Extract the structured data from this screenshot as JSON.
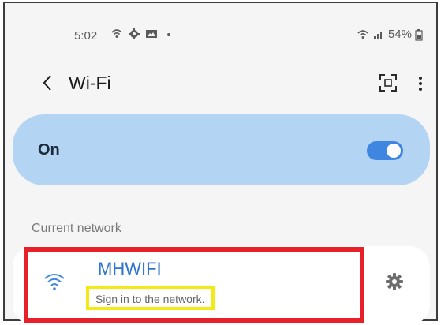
{
  "status_bar": {
    "time": "5:02",
    "left_icons": [
      "wifi-icon",
      "gear-icon",
      "image-icon",
      "dot-icon"
    ],
    "right_icons": [
      "wifi-icon",
      "signal-icon"
    ],
    "battery_percent": "54%"
  },
  "header": {
    "title": "Wi-Fi",
    "back_icon": "chevron-left-icon",
    "scan_icon": "qr-scan-icon",
    "more_icon": "more-vertical-icon"
  },
  "wifi_toggle": {
    "label": "On",
    "enabled": true
  },
  "current_network": {
    "section_label": "Current network",
    "name": "MHWIFI",
    "status": "Sign in to the network."
  },
  "colors": {
    "toggle_card_bg": "#b3d4f3",
    "accent_blue": "#3f86e0",
    "network_name": "#2f74cf",
    "highlight_red": "#e8202a",
    "highlight_yellow": "#f2ea14"
  }
}
